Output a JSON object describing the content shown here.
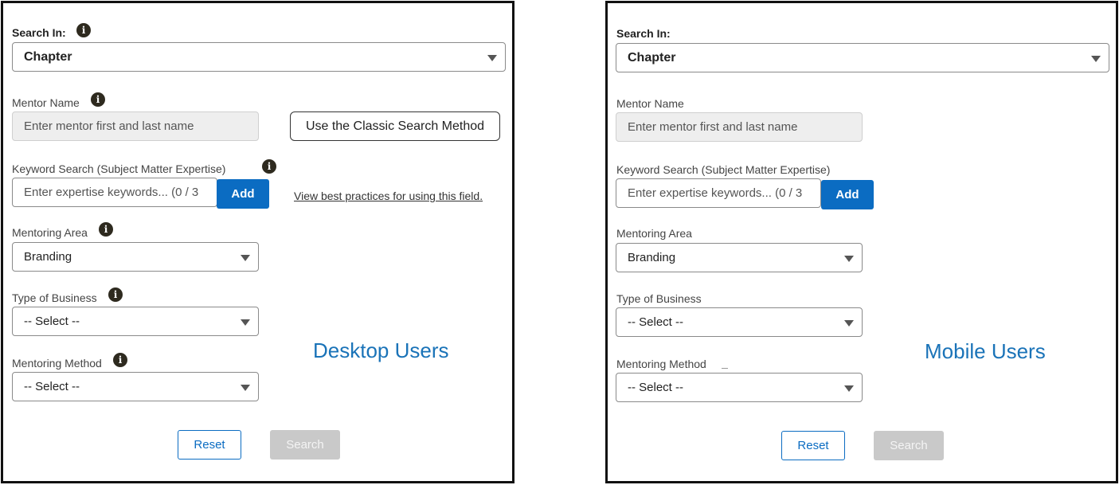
{
  "desktop": {
    "search_in_label": "Search In:",
    "search_in_value": "Chapter",
    "mentor_name_label": "Mentor Name",
    "mentor_name_placeholder": "Enter mentor first and last name",
    "classic_button": "Use the Classic Search Method",
    "keyword_label": "Keyword Search (Subject Matter Expertise)",
    "keyword_placeholder": "Enter expertise keywords... (0 / 3",
    "add_button": "Add",
    "best_practices_link": "View best practices for using this field.",
    "mentoring_area_label": "Mentoring Area",
    "mentoring_area_value": "Branding",
    "type_of_business_label": "Type of Business",
    "type_of_business_value": "-- Select --",
    "mentoring_method_label": "Mentoring Method",
    "mentoring_method_value": "-- Select --",
    "reset_button": "Reset",
    "search_button": "Search",
    "caption": "Desktop Users",
    "info_glyph": "i"
  },
  "mobile": {
    "search_in_label": "Search In:",
    "search_in_value": "Chapter",
    "mentor_name_label": "Mentor Name",
    "mentor_name_placeholder": "Enter mentor first and last name",
    "keyword_label": "Keyword Search (Subject Matter Expertise)",
    "keyword_placeholder": "Enter expertise keywords... (0 / 3",
    "add_button": "Add",
    "mentoring_area_label": "Mentoring Area",
    "mentoring_area_value": "Branding",
    "type_of_business_label": "Type of Business",
    "type_of_business_value": "-- Select --",
    "mentoring_method_label": "Mentoring Method",
    "mentoring_method_value": "-- Select --",
    "reset_button": "Reset",
    "search_button": "Search",
    "caption": "Mobile Users"
  },
  "colors": {
    "accent_blue": "#0b6cc2",
    "caption_blue": "#1a73b8",
    "disabled_gray": "#c9c9c9",
    "info_icon": "#2e2a1f"
  },
  "icons": [
    "info-icon",
    "chevron-down-icon"
  ]
}
